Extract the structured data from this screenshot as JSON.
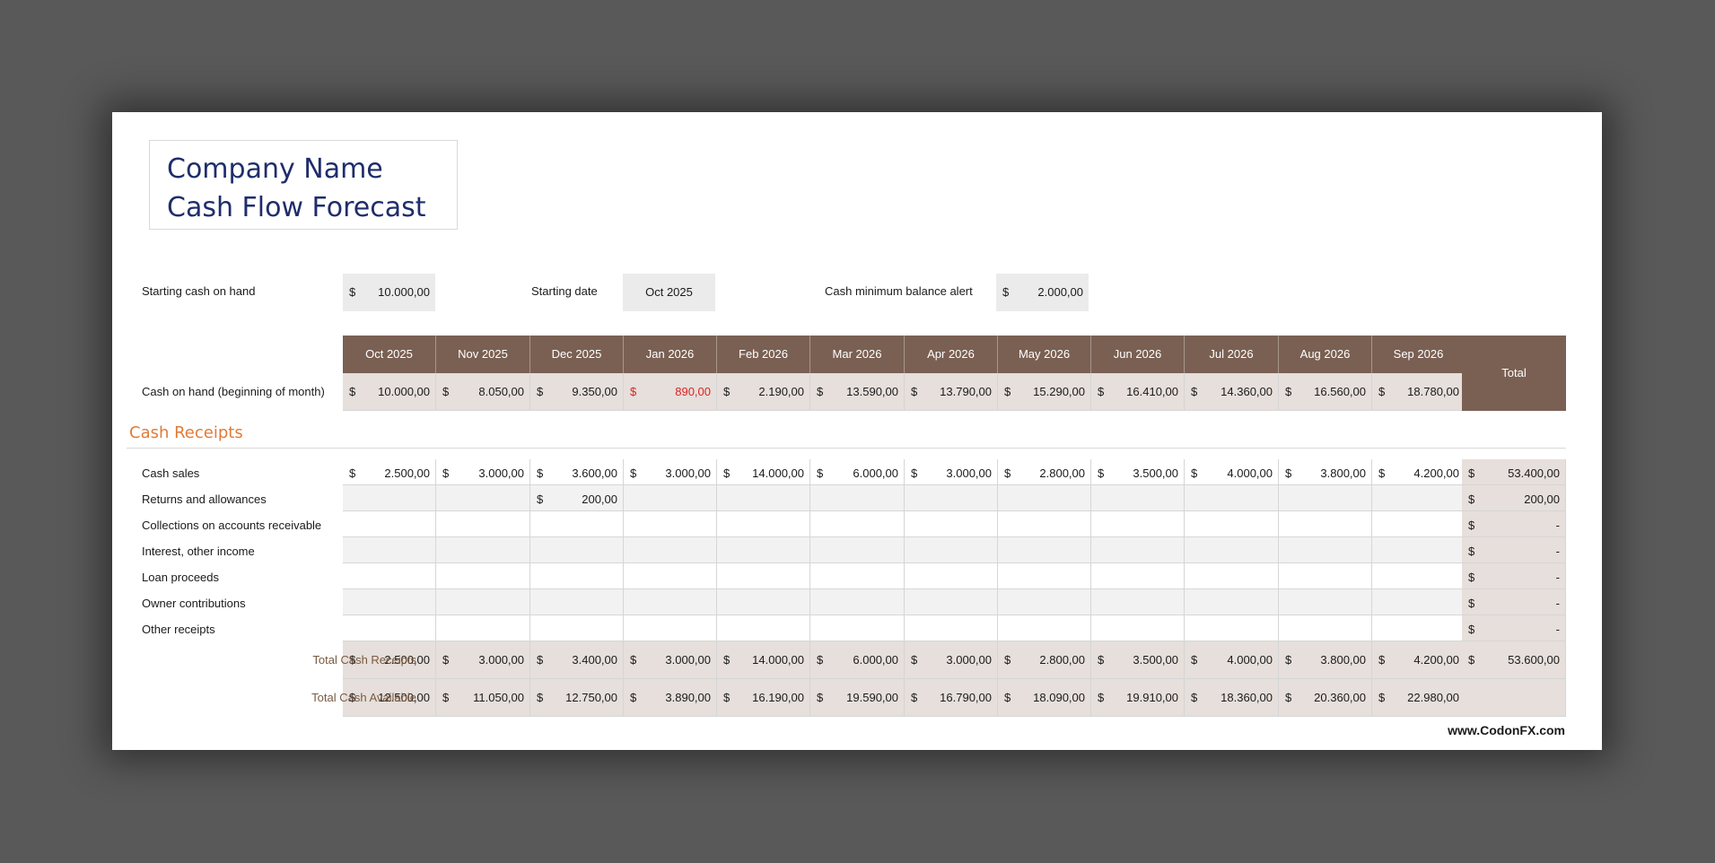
{
  "title": {
    "line1": "Company Name",
    "line2": "Cash Flow Forecast"
  },
  "inputs": {
    "starting_cash_label": "Starting cash on hand",
    "starting_cash_currency": "$",
    "starting_cash_value": "10.000,00",
    "starting_date_label": "Starting date",
    "starting_date_value": "Oct 2025",
    "min_balance_label": "Cash minimum balance alert",
    "min_balance_currency": "$",
    "min_balance_value": "2.000,00"
  },
  "months": [
    "Oct 2025",
    "Nov 2025",
    "Dec 2025",
    "Jan 2026",
    "Feb 2026",
    "Mar 2026",
    "Apr 2026",
    "May 2026",
    "Jun 2026",
    "Jul 2026",
    "Aug 2026",
    "Sep 2026"
  ],
  "total_header": "Total",
  "currency": "$",
  "cash_on_hand": {
    "label": "Cash on hand (beginning of month)",
    "values": [
      "10.000,00",
      "8.050,00",
      "9.350,00",
      "890,00",
      "2.190,00",
      "13.590,00",
      "13.790,00",
      "15.290,00",
      "16.410,00",
      "14.360,00",
      "16.560,00",
      "18.780,00"
    ],
    "alert_color": "#e02020"
  },
  "section_title": "Cash Receipts",
  "receipts": [
    {
      "label": "Cash sales",
      "values": [
        "2.500,00",
        "3.000,00",
        "3.600,00",
        "3.000,00",
        "14.000,00",
        "6.000,00",
        "3.000,00",
        "2.800,00",
        "3.500,00",
        "4.000,00",
        "3.800,00",
        "4.200,00"
      ],
      "total": "53.400,00"
    },
    {
      "label": "Returns and allowances",
      "values": [
        "",
        "",
        "200,00",
        "",
        "",
        "",
        "",
        "",
        "",
        "",
        "",
        ""
      ],
      "total": "200,00"
    },
    {
      "label": "Collections on accounts receivable",
      "values": [
        "",
        "",
        "",
        "",
        "",
        "",
        "",
        "",
        "",
        "",
        "",
        ""
      ],
      "total": "-"
    },
    {
      "label": "Interest, other income",
      "values": [
        "",
        "",
        "",
        "",
        "",
        "",
        "",
        "",
        "",
        "",
        "",
        ""
      ],
      "total": "-"
    },
    {
      "label": "Loan proceeds",
      "values": [
        "",
        "",
        "",
        "",
        "",
        "",
        "",
        "",
        "",
        "",
        "",
        ""
      ],
      "total": "-"
    },
    {
      "label": "Owner contributions",
      "values": [
        "",
        "",
        "",
        "",
        "",
        "",
        "",
        "",
        "",
        "",
        "",
        ""
      ],
      "total": "-"
    },
    {
      "label": "Other receipts",
      "values": [
        "",
        "",
        "",
        "",
        "",
        "",
        "",
        "",
        "",
        "",
        "",
        ""
      ],
      "total": "-"
    }
  ],
  "total_receipts": {
    "label": "Total Cash Receipts",
    "values": [
      "2.500,00",
      "3.000,00",
      "3.400,00",
      "3.000,00",
      "14.000,00",
      "6.000,00",
      "3.000,00",
      "2.800,00",
      "3.500,00",
      "4.000,00",
      "3.800,00",
      "4.200,00"
    ],
    "total": "53.600,00"
  },
  "total_available": {
    "label": "Total Cash Available",
    "values": [
      "12.500,00",
      "11.050,00",
      "12.750,00",
      "3.890,00",
      "16.190,00",
      "19.590,00",
      "16.790,00",
      "18.090,00",
      "19.910,00",
      "18.360,00",
      "20.360,00",
      "22.980,00"
    ]
  },
  "footer": "www.CodonFX.com",
  "colors": {
    "header_brown": "#7a6053",
    "title_navy": "#1f2d6b",
    "section_orange": "#e07b39",
    "shaded_cell": "#e6dfdb",
    "alt_row": "#f2f2f2"
  }
}
